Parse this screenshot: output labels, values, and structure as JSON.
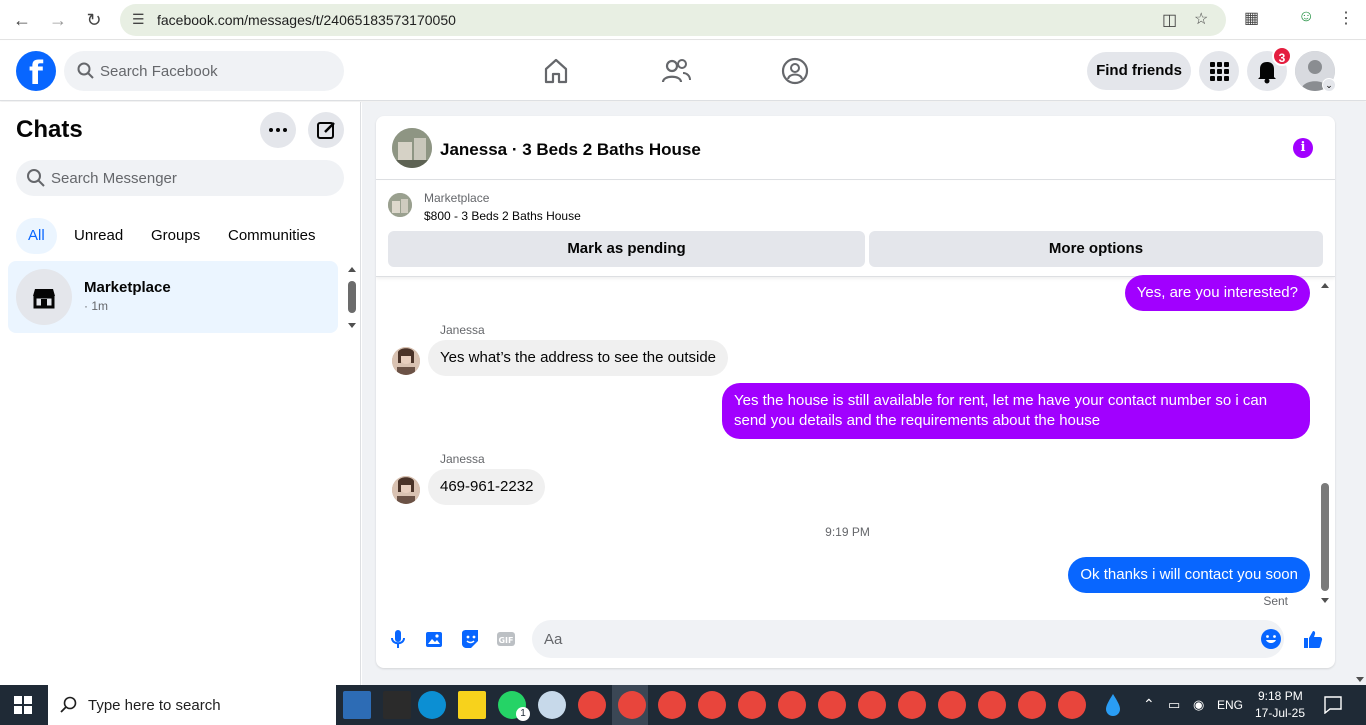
{
  "browser": {
    "url": "facebook.com/messages/t/24065183573170050"
  },
  "header": {
    "search_placeholder": "Search Facebook",
    "find_friends_label": "Find friends",
    "notifications_count": "3"
  },
  "sidebar": {
    "title": "Chats",
    "search_placeholder": "Search Messenger",
    "filters": [
      "All",
      "Unread",
      "Groups",
      "Communities"
    ],
    "active_filter": "All",
    "chats": [
      {
        "name": "Marketplace",
        "meta": "· 1m"
      }
    ]
  },
  "conversation": {
    "title": "Janessa · 3 Beds 2 Baths House",
    "listing": {
      "source": "Marketplace",
      "title": "$800 - 3 Beds 2 Baths House",
      "primary_button": "Mark as pending",
      "secondary_button": "More options"
    },
    "messages": [
      {
        "sender": "me",
        "text": "Yes, are you interested?"
      },
      {
        "sender": "Janessa",
        "text": "Yes what’s the address to see the outside"
      },
      {
        "sender": "me",
        "text": "Yes the house is still available for rent, let me have your contact number so i can send you details and the requirements about the house"
      },
      {
        "sender": "Janessa",
        "text": "469-961-2232"
      },
      {
        "sender": "me",
        "text": "Ok thanks i will contact you soon"
      }
    ],
    "timestamp": "9:19 PM",
    "sent_label": "Sent",
    "composer_placeholder": "Aa"
  },
  "taskbar": {
    "search_text": "Type here to search",
    "language": "ENG",
    "time": "9:18 PM",
    "date": "17-Jul-25",
    "whatsapp_badge": "1"
  },
  "colors": {
    "brand": "#0866ff",
    "theme_purple": "#a100ff",
    "notification": "#e41e3f"
  }
}
